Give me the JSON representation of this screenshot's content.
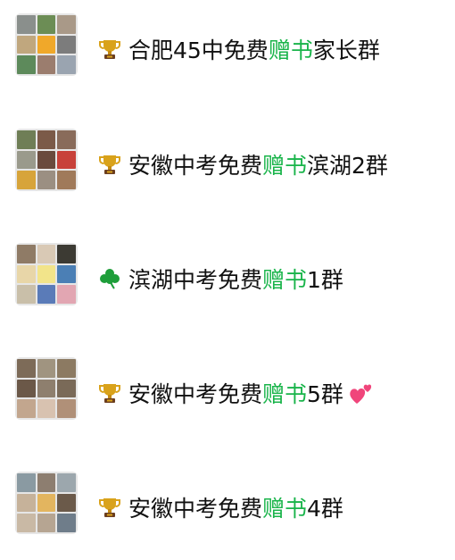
{
  "groups": [
    {
      "icon": "trophy-icon",
      "pre": "合肥45中免费",
      "hl": "赠书",
      "post": "家长群",
      "tiles": [
        "#8a8f8c",
        "#6c8d55",
        "#a99988",
        "#c0a77e",
        "#f0a82a",
        "#7c7c7c",
        "#5d8a5b",
        "#9b7d6e",
        "#9aa4b0"
      ]
    },
    {
      "icon": "trophy-icon",
      "pre": "安徽中考免费",
      "hl": "赠书",
      "post": "滨湖2群",
      "tiles": [
        "#6f7e56",
        "#7b5a48",
        "#896b5a",
        "#9a9a8c",
        "#6a4a3d",
        "#c8413a",
        "#d7a43a",
        "#9b8f82",
        "#a07a5a"
      ]
    },
    {
      "icon": "clover-icon",
      "pre": "滨湖中考免费",
      "hl": "赠书",
      "post": "1群",
      "tiles": [
        "#8f7b66",
        "#d9c9b5",
        "#3c3a33",
        "#e8d6a8",
        "#f2e48a",
        "#4b7fb5",
        "#c9bfa9",
        "#5a7bb8",
        "#e2a6b2"
      ]
    },
    {
      "icon": "trophy-icon",
      "pre": "安徽中考免费",
      "hl": "赠书",
      "post": "5群",
      "tiles": [
        "#7d6b58",
        "#a09480",
        "#8c7a62",
        "#6b5848",
        "#8e7f6e",
        "#7a6a58",
        "#c2a68e",
        "#d8c2b0",
        "#b09078"
      ],
      "heart": "two-hearts-icon"
    },
    {
      "icon": "trophy-icon",
      "pre": "安徽中考免费",
      "hl": "赠书",
      "post": "4群",
      "tiles": [
        "#8a9aa2",
        "#8d7e70",
        "#9ca7ad",
        "#c6b29a",
        "#e3b55f",
        "#6b5a4a",
        "#c9b9a5",
        "#b6a592",
        "#6f7d8a"
      ]
    }
  ],
  "colors": {
    "highlight": "#19b44a",
    "text": "#111111"
  }
}
